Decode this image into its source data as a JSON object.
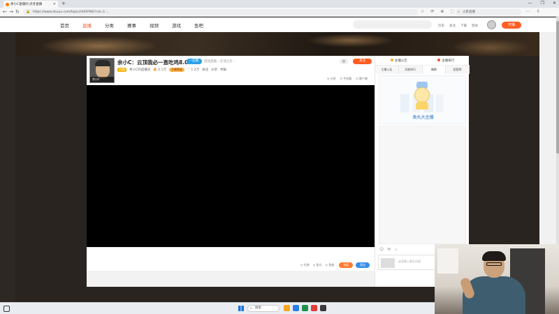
{
  "browser": {
    "tab_title": "余小C直播间 虎牙直播",
    "tab_close": "×",
    "new_tab": "+",
    "window_buttons": [
      "—",
      "❐",
      "✕"
    ],
    "nav": {
      "back": "←",
      "forward": "→",
      "reload": "↻"
    },
    "url": "https://www.douyu.com/topic/HUOYING?rid=1 ...",
    "toolbar_icons": [
      "☆",
      "⟳",
      "⊕",
      "⬚"
    ],
    "search_placeholder": "火影直播",
    "right_icons": [
      "⋯",
      "⇩"
    ]
  },
  "site": {
    "nav_items": [
      "首页",
      "直播",
      "分类",
      "赛事",
      "视频",
      "游戏",
      "鱼吧"
    ],
    "active_nav_index": 1,
    "links": [
      "历史",
      "关注",
      "下载",
      "登录"
    ],
    "live_button": "开播"
  },
  "room": {
    "streamer_tag": "余小C",
    "title": "余小C：云顶我必一直吃鸡8.01",
    "tag": "一起看",
    "category": "游戏直播 › 云顶之弈 ›",
    "fan_badge": "10级",
    "nickname": "余小C的直播间",
    "hot": "🔥 2.1万",
    "level_badge": "主播等级",
    "followers": "♡ 1.2万",
    "followers_label": "关注",
    "share": "分享",
    "report": "举报",
    "follow_button": "关注",
    "circle_icon": "◎",
    "actions": [
      "⊟ 分享",
      "⊟ 手机看",
      "⊟ 客户端"
    ]
  },
  "player_bottom": {
    "actions": [
      "◎ 礼物",
      "◎ 鱼丸",
      "◎ 鱼翅"
    ],
    "orange_button": "充值",
    "blue_button": "背包"
  },
  "chat": {
    "top_left": "主播公告",
    "top_right": "主播排行",
    "tabs": [
      "主播公告",
      "贡献排行",
      "周榜",
      "超管榜"
    ],
    "active_tab_index": 2,
    "mascot_text": "鱼丸大主播",
    "tools": [
      "☺",
      "✉",
      "♨"
    ],
    "input_placeholder": "这里输入聊天内容"
  },
  "taskbar": {
    "search_label": "搜索",
    "app_colors": [
      "#f5a623",
      "#2b7de9",
      "#1f8f4e",
      "#e23b3b",
      "#3a3a3a"
    ]
  }
}
